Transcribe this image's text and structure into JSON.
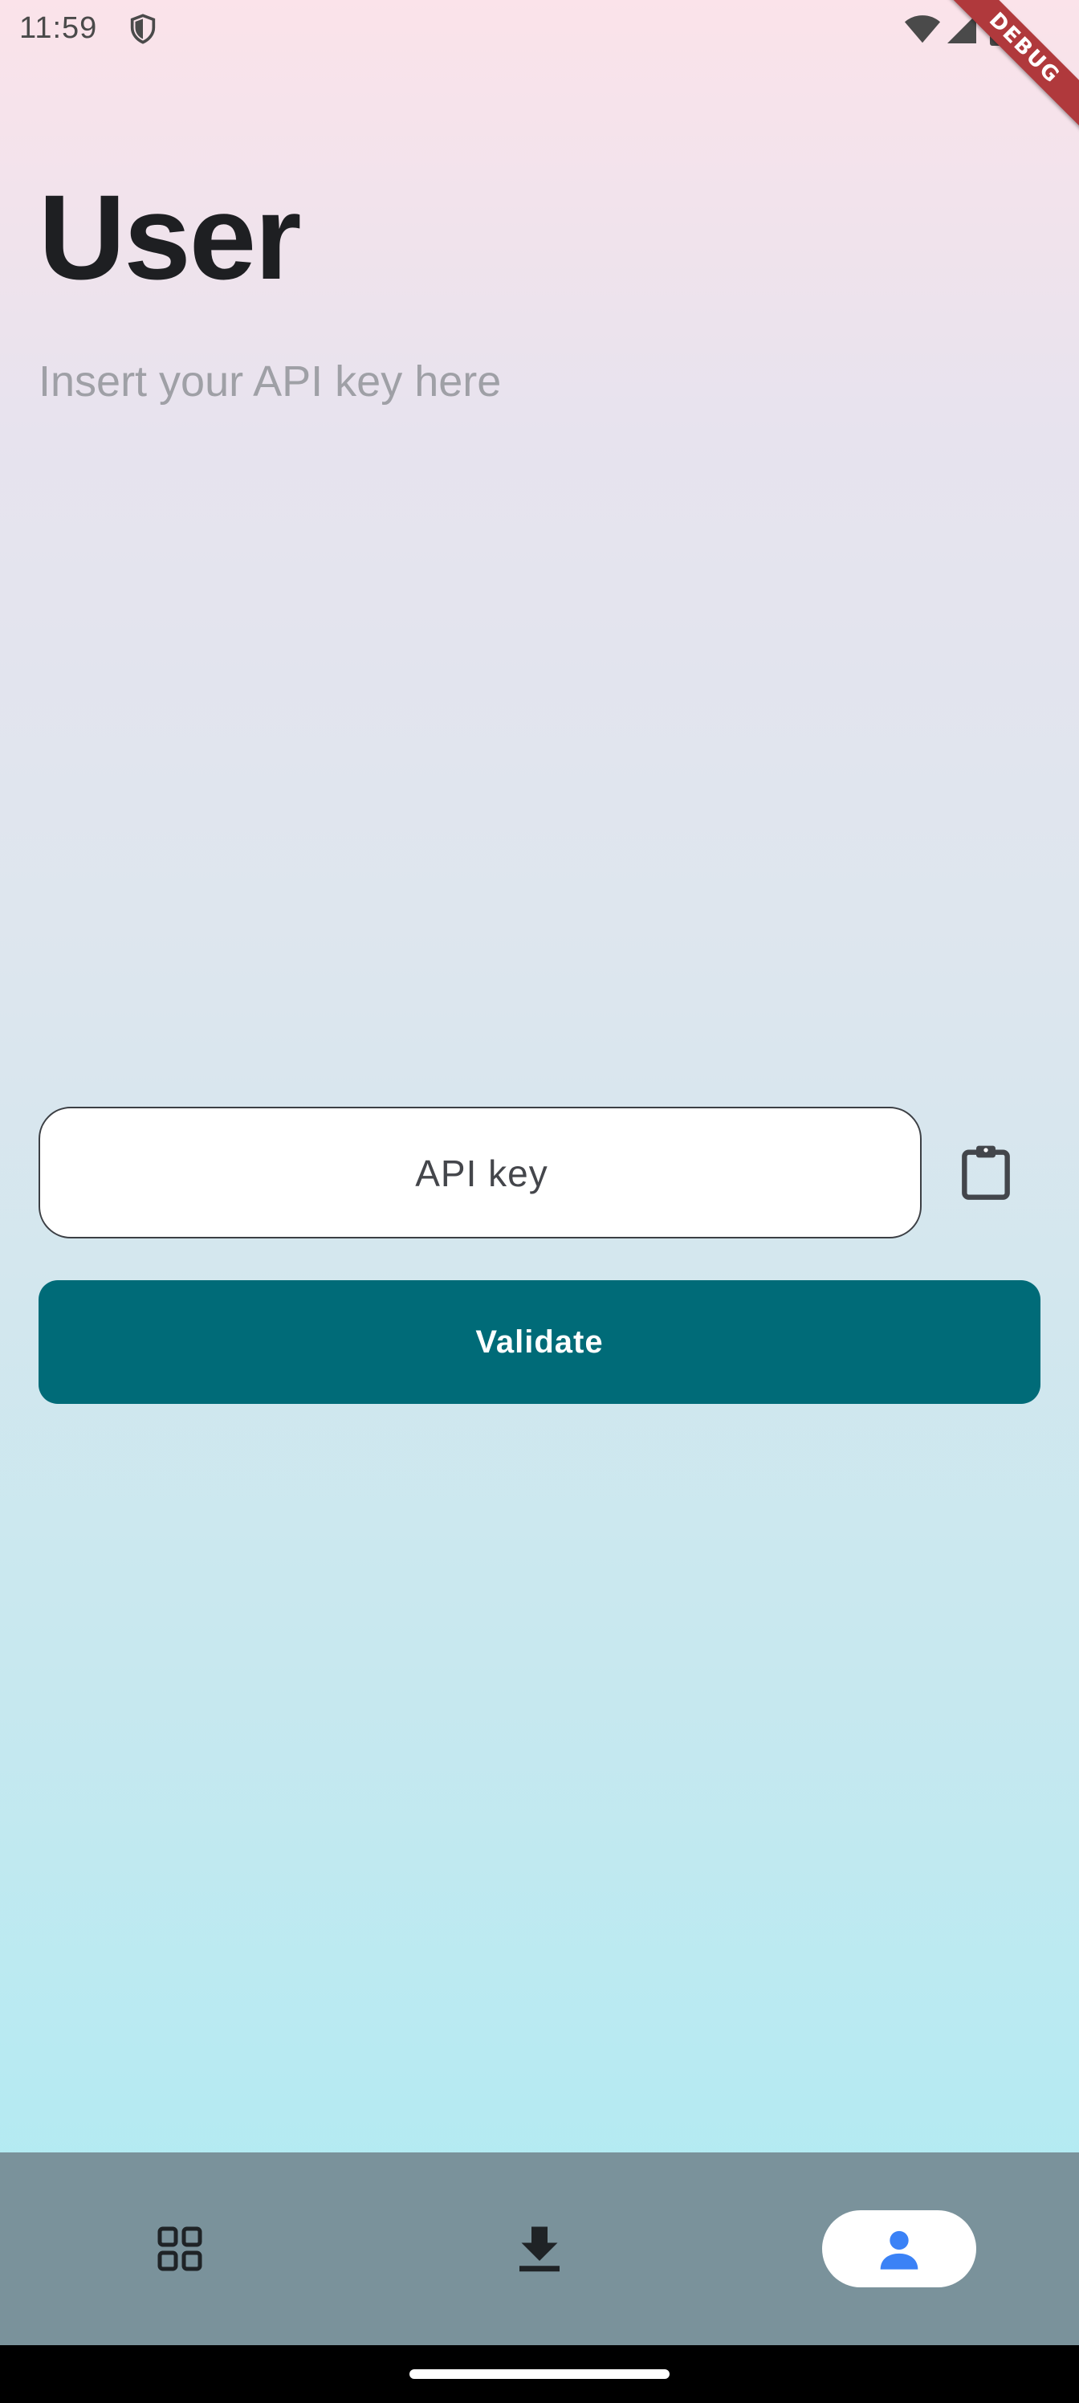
{
  "status_bar": {
    "time": "11:59",
    "icons": [
      "shield-icon",
      "wifi-icon",
      "signal-icon",
      "battery-icon"
    ]
  },
  "debug_banner": "DEBUG",
  "page": {
    "title": "User",
    "subtitle": "Insert your API key here"
  },
  "form": {
    "api_key_placeholder": "API key",
    "api_key_value": "",
    "paste_icon": "clipboard-icon",
    "validate_label": "Validate"
  },
  "bottom_nav": {
    "items": [
      {
        "icon": "grid-icon",
        "selected": false
      },
      {
        "icon": "download-icon",
        "selected": false
      },
      {
        "icon": "user-icon",
        "selected": true
      }
    ]
  },
  "colors": {
    "accent": "#006b78",
    "nav_bar": "#7a929b",
    "selected_icon": "#3b82f6",
    "debug_ribbon": "#b0393c"
  }
}
